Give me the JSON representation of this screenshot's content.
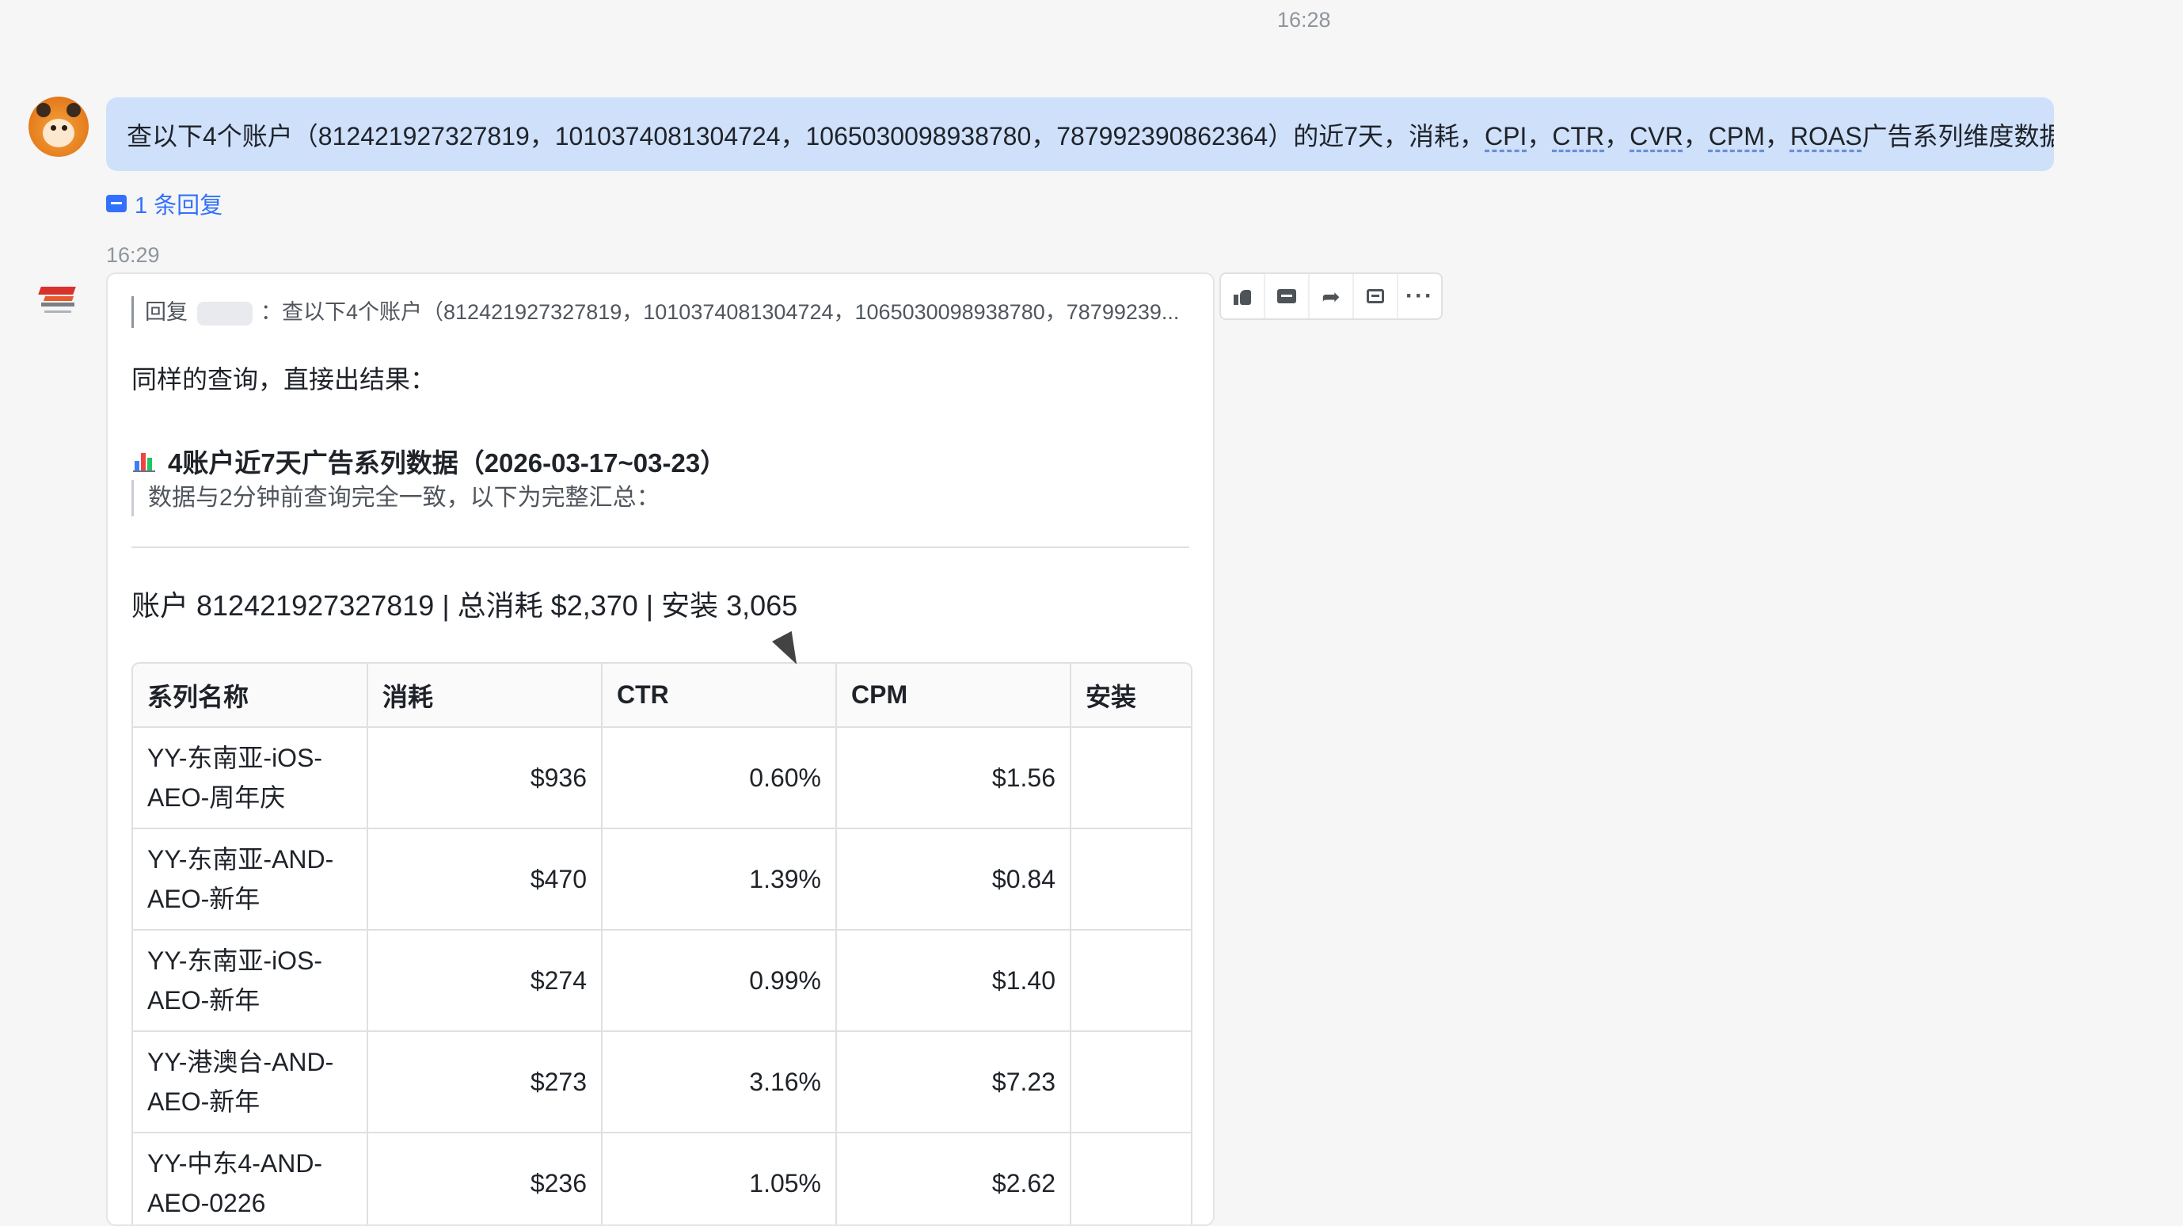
{
  "header": {
    "timestamp": "16:28"
  },
  "user_message": {
    "segments": [
      {
        "text": "查以下4个账户（812421927327819，1010374081304724，1065030098938780，787992390862364）的近7天，消耗，",
        "u": false
      },
      {
        "text": "CPI",
        "u": true
      },
      {
        "text": "，",
        "u": false
      },
      {
        "text": "CTR",
        "u": true
      },
      {
        "text": "，",
        "u": false
      },
      {
        "text": "CVR",
        "u": true
      },
      {
        "text": "，",
        "u": false
      },
      {
        "text": "CPM",
        "u": true
      },
      {
        "text": "，",
        "u": false
      },
      {
        "text": "ROAS",
        "u": true
      },
      {
        "text": "广告系列维度数据",
        "u": false
      }
    ],
    "reply_count_label": "1 条回复"
  },
  "bot_message": {
    "timestamp": "16:29",
    "quote_prefix": "回复",
    "quote_text": "：查以下4个账户（812421927327819，1010374081304724，1065030098938780，78799239...",
    "intro": "同样的查询，直接出结果：",
    "section_title": "4账户近7天广告系列数据（2026-03-17~03-23）",
    "note": "数据与2分钟前查询完全一致，以下为完整汇总：",
    "account_line": "账户 812421927327819 | 总消耗 $2,370 | 安装 3,065",
    "table": {
      "headers": [
        "系列名称",
        "消耗",
        "CTR",
        "CPM",
        "安装"
      ],
      "rows": [
        {
          "name_l1": "YY-东南亚-iOS-",
          "name_l2": "AEO-周年庆",
          "spend": "$936",
          "ctr": "0.60%",
          "cpm": "$1.56",
          "installs": ""
        },
        {
          "name_l1": "YY-东南亚-AND-",
          "name_l2": "AEO-新年",
          "spend": "$470",
          "ctr": "1.39%",
          "cpm": "$0.84",
          "installs": ""
        },
        {
          "name_l1": "YY-东南亚-iOS-",
          "name_l2": "AEO-新年",
          "spend": "$274",
          "ctr": "0.99%",
          "cpm": "$1.40",
          "installs": ""
        },
        {
          "name_l1": "YY-港澳台-AND-",
          "name_l2": "AEO-新年",
          "spend": "$273",
          "ctr": "3.16%",
          "cpm": "$7.23",
          "installs": ""
        },
        {
          "name_l1": "YY-中东4-AND-",
          "name_l2": "AEO-0226",
          "spend": "$236",
          "ctr": "1.05%",
          "cpm": "$2.62",
          "installs": ""
        }
      ]
    }
  },
  "toolbar": {
    "items": [
      {
        "icon": "thumbs-up-icon"
      },
      {
        "icon": "comment-icon"
      },
      {
        "icon": "forward-icon"
      },
      {
        "icon": "mark-icon"
      },
      {
        "icon": "more-icon"
      }
    ]
  },
  "colors": {
    "user_bubble": "#cfe0fb",
    "link": "#3370ff",
    "background": "#f5f6f5"
  }
}
